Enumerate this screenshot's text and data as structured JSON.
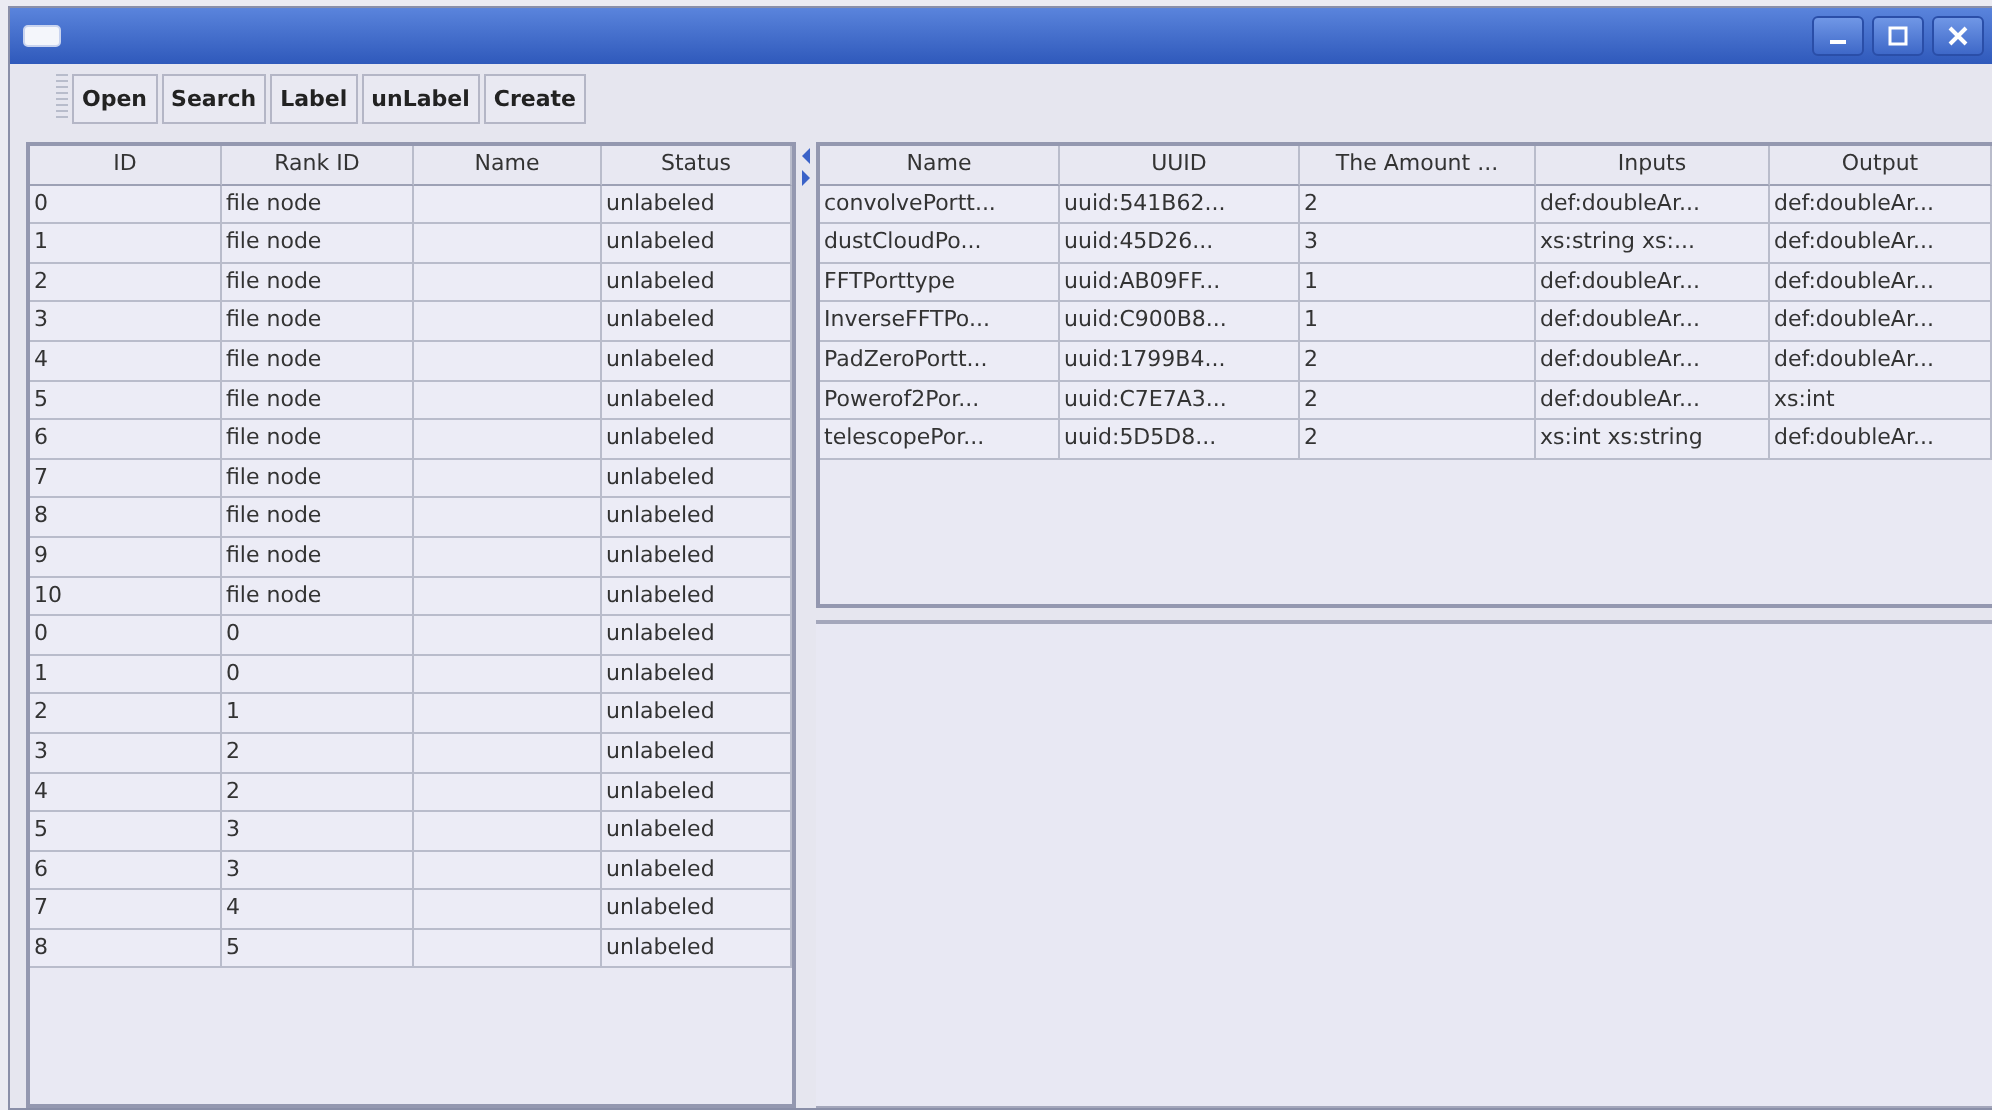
{
  "toolbar": {
    "buttons": [
      "Open",
      "Search",
      "Label",
      "unLabel",
      "Create"
    ]
  },
  "nodes_table": {
    "columns": [
      "ID",
      "Rank ID",
      "Name",
      "Status"
    ],
    "rows": [
      [
        "0",
        "file node",
        "",
        "unlabeled"
      ],
      [
        "1",
        "file node",
        "",
        "unlabeled"
      ],
      [
        "2",
        "file node",
        "",
        "unlabeled"
      ],
      [
        "3",
        "file node",
        "",
        "unlabeled"
      ],
      [
        "4",
        "file node",
        "",
        "unlabeled"
      ],
      [
        "5",
        "file node",
        "",
        "unlabeled"
      ],
      [
        "6",
        "file node",
        "",
        "unlabeled"
      ],
      [
        "7",
        "file node",
        "",
        "unlabeled"
      ],
      [
        "8",
        "file node",
        "",
        "unlabeled"
      ],
      [
        "9",
        "file node",
        "",
        "unlabeled"
      ],
      [
        "10",
        "file node",
        "",
        "unlabeled"
      ],
      [
        "0",
        "0",
        "",
        "unlabeled"
      ],
      [
        "1",
        "0",
        "",
        "unlabeled"
      ],
      [
        "2",
        "1",
        "",
        "unlabeled"
      ],
      [
        "3",
        "2",
        "",
        "unlabeled"
      ],
      [
        "4",
        "2",
        "",
        "unlabeled"
      ],
      [
        "5",
        "3",
        "",
        "unlabeled"
      ],
      [
        "6",
        "3",
        "",
        "unlabeled"
      ],
      [
        "7",
        "4",
        "",
        "unlabeled"
      ],
      [
        "8",
        "5",
        "",
        "unlabeled"
      ]
    ]
  },
  "ports_table": {
    "columns": [
      "Name",
      "UUID",
      "The Amount ...",
      "Inputs",
      "Output"
    ],
    "rows": [
      [
        "convolvePortt...",
        "uuid:541B62...",
        "2",
        "def:doubleAr...",
        "def:doubleAr..."
      ],
      [
        "dustCloudPo...",
        "uuid:45D26...",
        "3",
        "xs:string xs:...",
        "def:doubleAr..."
      ],
      [
        "FFTPorttype",
        "uuid:AB09FF...",
        "1",
        "def:doubleAr...",
        "def:doubleAr..."
      ],
      [
        "InverseFFTPo...",
        "uuid:C900B8...",
        "1",
        "def:doubleAr...",
        "def:doubleAr..."
      ],
      [
        "PadZeroPortt...",
        "uuid:1799B4...",
        "2",
        "def:doubleAr...",
        "def:doubleAr..."
      ],
      [
        "Powerof2Por...",
        "uuid:C7E7A3...",
        "2",
        "def:doubleAr...",
        "xs:int"
      ],
      [
        "telescopePor...",
        "uuid:5D5D8...",
        "2",
        "xs:int xs:string",
        "def:doubleAr..."
      ]
    ]
  }
}
